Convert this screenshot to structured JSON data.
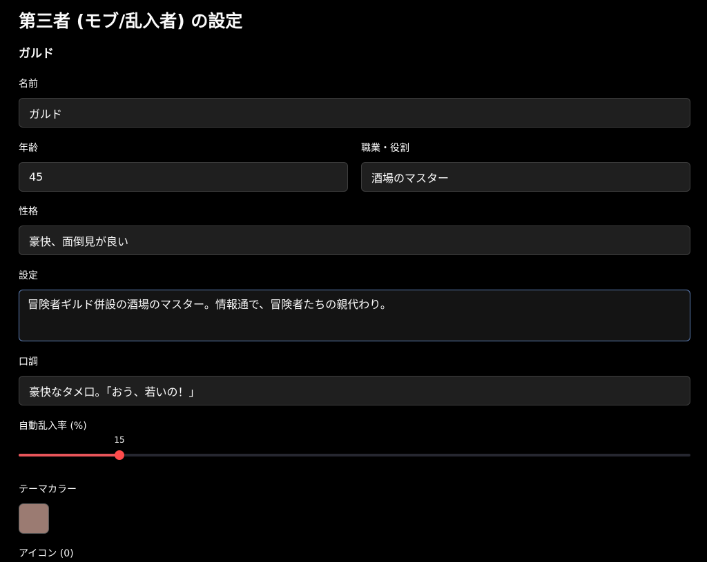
{
  "page": {
    "title": "第三者 (モブ/乱入者) の設定"
  },
  "character": {
    "section_title": "ガルド",
    "name": {
      "label": "名前",
      "value": "ガルド"
    },
    "age": {
      "label": "年齢",
      "value": "45"
    },
    "role": {
      "label": "職業・役割",
      "value": "酒場のマスター"
    },
    "personality": {
      "label": "性格",
      "value": "豪快、面倒見が良い"
    },
    "setting": {
      "label": "設定",
      "value": "冒険者ギルド併設の酒場のマスター。情報通で、冒険者たちの親代わり。"
    },
    "speech": {
      "label": "口調",
      "value": "豪快なタメ口。「おう、若いの！」"
    },
    "auto_intrusion": {
      "label": "自動乱入率 (%)",
      "value": 15,
      "display": "15",
      "min": 0,
      "max": 100
    },
    "theme_color": {
      "label": "テーマカラー",
      "value": "#9b7b72"
    },
    "icon": {
      "label": "アイコン (0)"
    }
  },
  "colors": {
    "accent": "#ff4b4b",
    "focus_border": "#5d7fb6"
  }
}
